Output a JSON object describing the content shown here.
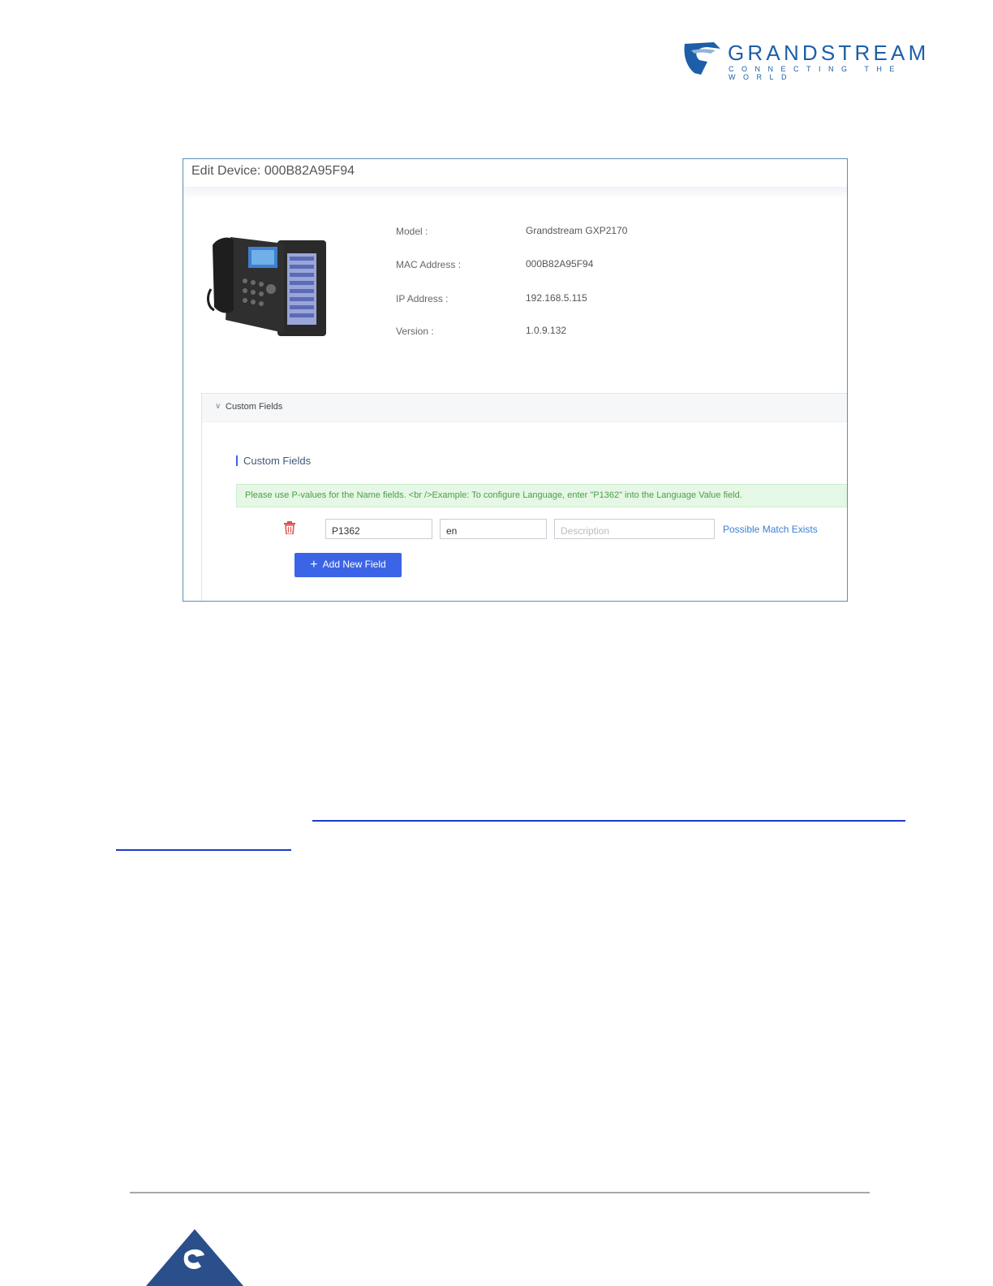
{
  "logo": {
    "wordmark": "GRANDSTREAM",
    "tagline": "CONNECTING THE WORLD",
    "colors": {
      "primary": "#1c5fa8",
      "accent": "#8fb4d9"
    }
  },
  "screenshot": {
    "title": "Edit Device: 000B82A95F94",
    "device_info": [
      {
        "label": "Model :",
        "value": "Grandstream GXP2170"
      },
      {
        "label": "MAC Address :",
        "value": "000B82A95F94"
      },
      {
        "label": "IP Address :",
        "value": "192.168.5.115"
      },
      {
        "label": "Version :",
        "value": "1.0.9.132"
      }
    ],
    "custom_fields": {
      "collapse_label": "Custom Fields",
      "section_title": "Custom Fields",
      "note": "Please use P-values for the Name fields. <br />Example: To configure Language, enter \"P1362\" into the Language Value field.",
      "row": {
        "name_value": "P1362",
        "value_value": "en",
        "description_placeholder": "Description",
        "match_link": "Possible Match Exists"
      },
      "add_button_label": "Add New Field"
    },
    "colors": {
      "button": "#3c64e6",
      "note_bg": "#e5f7e5",
      "note_text": "#4c9e4c",
      "delete": "#e05050"
    }
  }
}
